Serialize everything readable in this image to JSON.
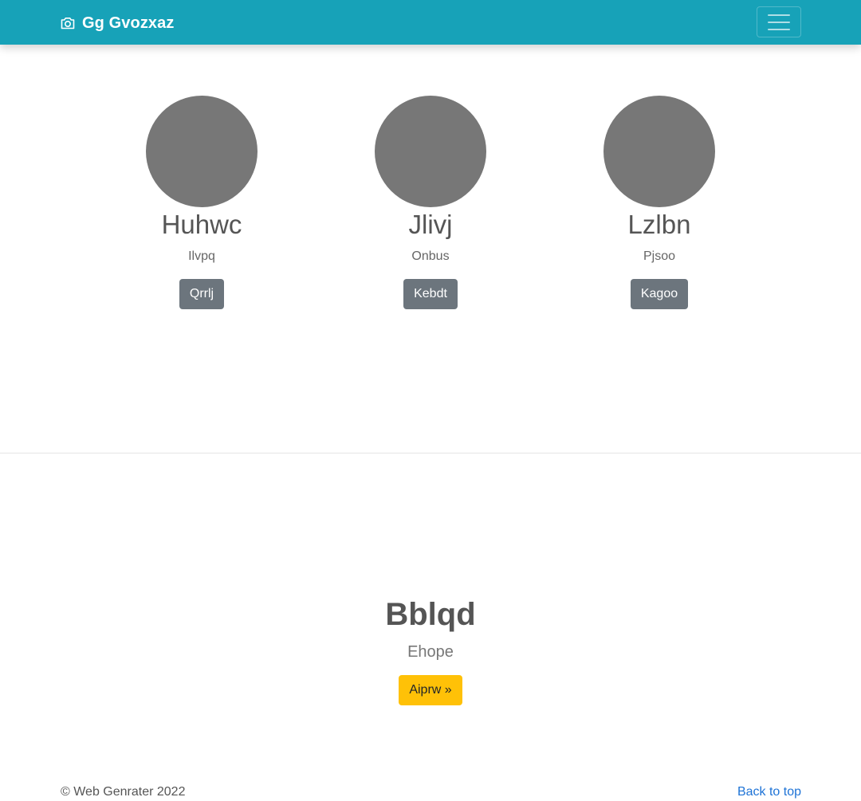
{
  "navbar": {
    "brand_text": "Gg Gvozxaz",
    "brand_icon": "camera-icon",
    "toggler_icon": "hamburger-menu-icon",
    "color": "#17a2b8"
  },
  "cards": [
    {
      "name": "Huhwc",
      "subtitle": "Ilvpq",
      "button_label": "Qrrlj"
    },
    {
      "name": "Jlivj",
      "subtitle": "Onbus",
      "button_label": "Kebdt"
    },
    {
      "name": "Lzlbn",
      "subtitle": "Pjsoo",
      "button_label": "Kagoo"
    }
  ],
  "hero": {
    "title": "Bblqd",
    "subtitle": "Ehope",
    "button_label": "Aiprw »",
    "button_color": "#ffc107"
  },
  "footer": {
    "copyright": "© Web Genrater 2022",
    "back_to_top": "Back to top"
  }
}
